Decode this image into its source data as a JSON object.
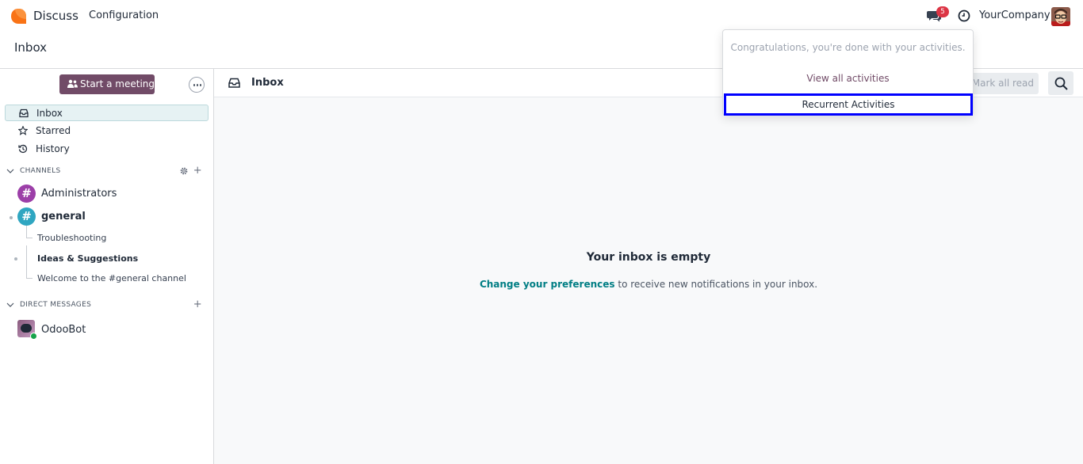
{
  "navbar": {
    "app_name": "Discuss",
    "menu_configuration": "Configuration",
    "message_badge": "5",
    "company": "YourCompany"
  },
  "control_panel": {
    "title": "Inbox"
  },
  "sidebar": {
    "start_meeting": "Start a meeting",
    "nav": [
      {
        "label": "Inbox",
        "icon": "inbox-icon"
      },
      {
        "label": "Starred",
        "icon": "star-icon"
      },
      {
        "label": "History",
        "icon": "history-icon"
      }
    ],
    "channels_header": "CHANNELS",
    "channels": [
      {
        "label": "Administrators",
        "color": "#9c3fa8"
      },
      {
        "label": "general",
        "color": "#2fa6c1"
      }
    ],
    "threads": [
      {
        "label": "Troubleshooting"
      },
      {
        "label": "Ideas & Suggestions"
      },
      {
        "label": "Welcome to the #general channel"
      }
    ],
    "direct_messages_header": "DIRECT MESSAGES",
    "direct_messages": [
      {
        "label": "OdooBot"
      }
    ]
  },
  "main": {
    "thread_title": "Inbox",
    "mark_all_read": "Mark all read",
    "empty_title": "Your inbox is empty",
    "empty_link": "Change your preferences",
    "empty_text": " to receive new notifications in your inbox."
  },
  "activity_dropdown": {
    "congrats": "Congratulations, you're done with your activities.",
    "view_all": "View all activities",
    "recurrent": "Recurrent Activities"
  },
  "colors": {
    "brand": "#714b67",
    "link": "#017e84",
    "badge": "#dc3545",
    "highlight_border": "#0000ff"
  }
}
